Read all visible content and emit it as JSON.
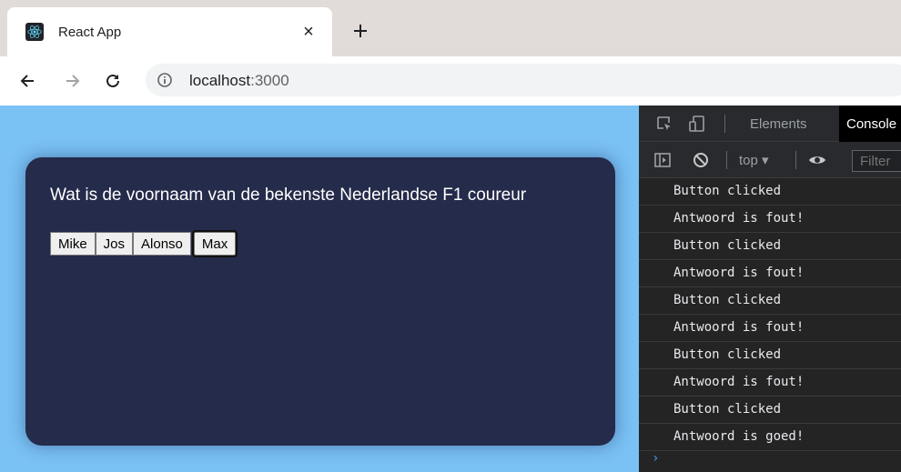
{
  "tab": {
    "title": "React App",
    "close_glyph": "×"
  },
  "toolbar": {
    "url_host": "localhost",
    "url_port": ":3000"
  },
  "page": {
    "question": "Wat is de voornaam van de bekenste Nederlandse F1 coureur",
    "answers": [
      "Mike",
      "Jos",
      "Alonso",
      "Max"
    ],
    "colors": {
      "background": "#7ac1f4",
      "card": "#252b4a"
    }
  },
  "devtools": {
    "tabs": [
      "Elements",
      "Console"
    ],
    "context": "top ▾",
    "filter_placeholder": "Filter",
    "logs": [
      "Button clicked",
      "Antwoord is fout!",
      "Button clicked",
      "Antwoord is fout!",
      "Button clicked",
      "Antwoord is fout!",
      "Button clicked",
      "Antwoord is fout!",
      "Button clicked",
      "Antwoord is goed!"
    ],
    "prompt": "›"
  }
}
